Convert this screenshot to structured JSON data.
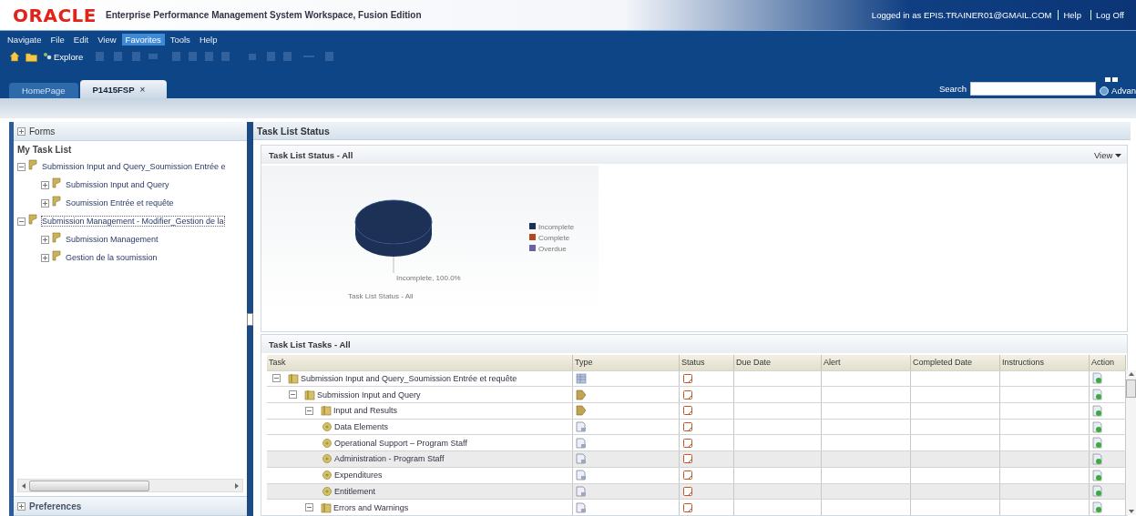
{
  "header": {
    "logo": "ORACLE",
    "title": "Enterprise Performance Management System Workspace, Fusion Edition",
    "user_text": "Logged in as EPIS.TRAINER01@GMAIL.COM",
    "links": [
      "Help",
      "Log Off"
    ]
  },
  "menu": [
    {
      "label": "Navigate",
      "selected": false
    },
    {
      "label": "File",
      "selected": false
    },
    {
      "label": "Edit",
      "selected": false
    },
    {
      "label": "View",
      "selected": false
    },
    {
      "label": "Favorites",
      "selected": true
    },
    {
      "label": "Tools",
      "selected": false
    },
    {
      "label": "Help",
      "selected": false
    }
  ],
  "toolbar": {
    "explore": "Explore"
  },
  "tabs": [
    {
      "label": "HomePage",
      "selected": false
    },
    {
      "label": "P1415FSP",
      "selected": true,
      "close": "×"
    }
  ],
  "search": {
    "label": "Search",
    "advanced": "Advan"
  },
  "forms_panel": {
    "title": "Forms",
    "expanded": false
  },
  "task_list": {
    "title": "My Task List",
    "items": [
      {
        "label": "Submission Input and Query_Soumission Entrée e",
        "expanded": true,
        "selected": false,
        "children": [
          {
            "label": "Submission Input and Query",
            "expanded": false,
            "selected": false
          },
          {
            "label": "Soumission Entrée et requête",
            "expanded": false,
            "selected": false
          }
        ]
      },
      {
        "label": "Submission Management - Modifier_Gestion de la",
        "expanded": true,
        "selected": true,
        "children": [
          {
            "label": "Submission Management",
            "expanded": false,
            "selected": false
          },
          {
            "label": "Gestion de la soumission",
            "expanded": false,
            "selected": false
          }
        ]
      }
    ]
  },
  "preferences_panel": {
    "title": "Preferences",
    "expanded": false
  },
  "status_section": {
    "title": "Task List Status"
  },
  "status_panel": {
    "title": "Task List Status - All",
    "view": "View",
    "legend": [
      {
        "color": "#1d3157"
      },
      {
        "color": "#b4481f"
      },
      {
        "color": "#6d5fa3"
      }
    ],
    "chart_data": {
      "type": "pie",
      "title": "Task List Status - All",
      "categories": [
        "Incomplete",
        "Complete",
        "Overdue"
      ],
      "series": [
        {
          "values": [
            100,
            0,
            0
          ]
        }
      ],
      "annotations": [
        "Incomplete, 100.0%"
      ]
    }
  },
  "tasks_panel": {
    "title": "Task List Tasks - All",
    "columns": [
      "Task",
      "Type",
      "Status",
      "Due Date",
      "Alert",
      "Completed Date",
      "Instructions",
      "Action"
    ],
    "rows": [
      {
        "task": "Submission Input and Query_Soumission Entrée et requête",
        "kind": "form",
        "expanded": true,
        "children": [
          {
            "task": "Submission Input and Query",
            "kind": "process",
            "expanded": true,
            "children": [
              {
                "task": "Input and Results",
                "kind": "process",
                "expanded": true,
                "children": [
                  {
                    "task": "Data Elements",
                    "kind": "task"
                  },
                  {
                    "task": "Operational Support – Program Staff",
                    "kind": "task"
                  },
                  {
                    "task": "Administration - Program Staff",
                    "kind": "task"
                  },
                  {
                    "task": "Expenditures",
                    "kind": "task"
                  },
                  {
                    "task": "Entitlement",
                    "kind": "task"
                  }
                ]
              },
              {
                "task": "Errors and Warnings",
                "kind": "task",
                "expanded": true
              }
            ]
          }
        ]
      }
    ]
  }
}
